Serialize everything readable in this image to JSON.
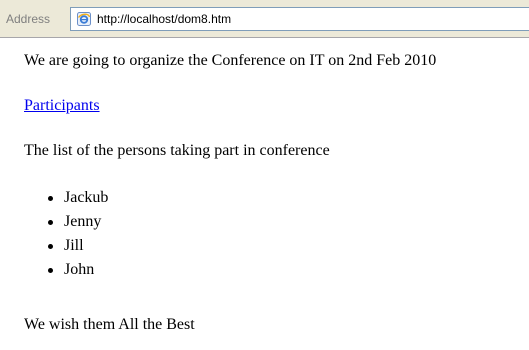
{
  "address_bar": {
    "label": "Address",
    "url": "http://localhost/dom8.htm",
    "icon": "ie-page-icon"
  },
  "page": {
    "intro": "We are going to organize the Conference on IT on 2nd Feb 2010",
    "link_text": "Participants",
    "list_intro": "The list of the persons taking part in conference",
    "participants": [
      {
        "name": "Jackub"
      },
      {
        "name": "Jenny"
      },
      {
        "name": "Jill"
      },
      {
        "name": "John"
      }
    ],
    "closing": "We wish them All the Best"
  },
  "colors": {
    "link": "#0000ee",
    "toolbar_bg": "#ece9d8",
    "address_label": "#7f7f7f"
  }
}
